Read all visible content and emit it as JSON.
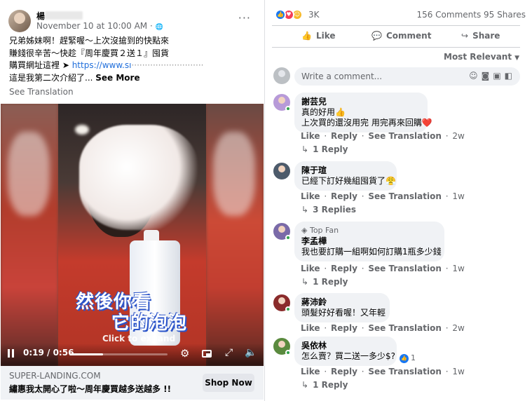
{
  "post": {
    "author": "楊",
    "date": "November 10 at 10:00 AM · ",
    "globe": "🌐",
    "menu": "···",
    "text_lines": [
      "兄弟姊妹啊！趕緊喔～上次沒搶到的快點來",
      "賺錢很辛苦～快趁『周年慶買２送１』囤貨",
      "購買網址這裡 ➤ "
    ],
    "link_text": "https://www.sı",
    "last_line": "這是我第二次介紹了... ",
    "see_more": "See More",
    "see_translation": "See Translation"
  },
  "video": {
    "caption_line1": "然後你看",
    "caption_line2": "它的泡泡",
    "click_to_expand": "Click to expand",
    "time": "0:19 / 0:56",
    "progress_fraction": 0.34,
    "icons": {
      "pause": "pause-icon",
      "settings": "gear-icon",
      "pip": "pip-icon",
      "expand": "expand-icon",
      "volume": "volume-icon"
    }
  },
  "link_card": {
    "domain": "SUPER-LANDING.COM",
    "title": "繡惠我太開心了啦～周年慶買越多送越多 !!",
    "cta": "Shop Now"
  },
  "stats": {
    "reaction_count": "3K",
    "comments": "156 Comments",
    "shares": "95 Shares"
  },
  "actions": {
    "like": "Like",
    "comment": "Comment",
    "share": "Share"
  },
  "sort": "Most Relevant",
  "write_placeholder": "Write a comment...",
  "comments": [
    {
      "name": "謝芸兒",
      "badge": "",
      "lines": [
        "真的好用👍",
        "上次買的還沒用完 用完再來回購❤️"
      ],
      "time": "2w",
      "replies": "1 Reply",
      "avatar": "#b79ad8",
      "online": true
    },
    {
      "name": "陳于瑄",
      "badge": "",
      "lines": [
        "已經下訂好幾組囤貨了😤"
      ],
      "time": "1w",
      "replies": "3 Replies",
      "avatar": "#4d5b6b",
      "online": false
    },
    {
      "name": "李孟樺",
      "badge": "Top Fan",
      "lines": [
        "我也要訂購一組啊如何訂購1瓶多少錢"
      ],
      "time": "1w",
      "replies": "1 Reply",
      "avatar": "#7a6aa8",
      "online": true
    },
    {
      "name": "蔣沛鈴",
      "badge": "",
      "lines": [
        "頭髮好好看喔！又年輕"
      ],
      "time": "2w",
      "replies": "",
      "avatar": "#8a2b2b",
      "online": true
    },
    {
      "name": "吳依林",
      "badge": "",
      "lines": [
        "怎么賣？買二送一多少$?"
      ],
      "time": "1w",
      "replies": "1 Reply",
      "avatar": "#5a8a3e",
      "online": true,
      "reaction_count": "1"
    }
  ],
  "comment_actions": {
    "like": "Like",
    "reply": "Reply",
    "see_translation": "See Translation"
  }
}
